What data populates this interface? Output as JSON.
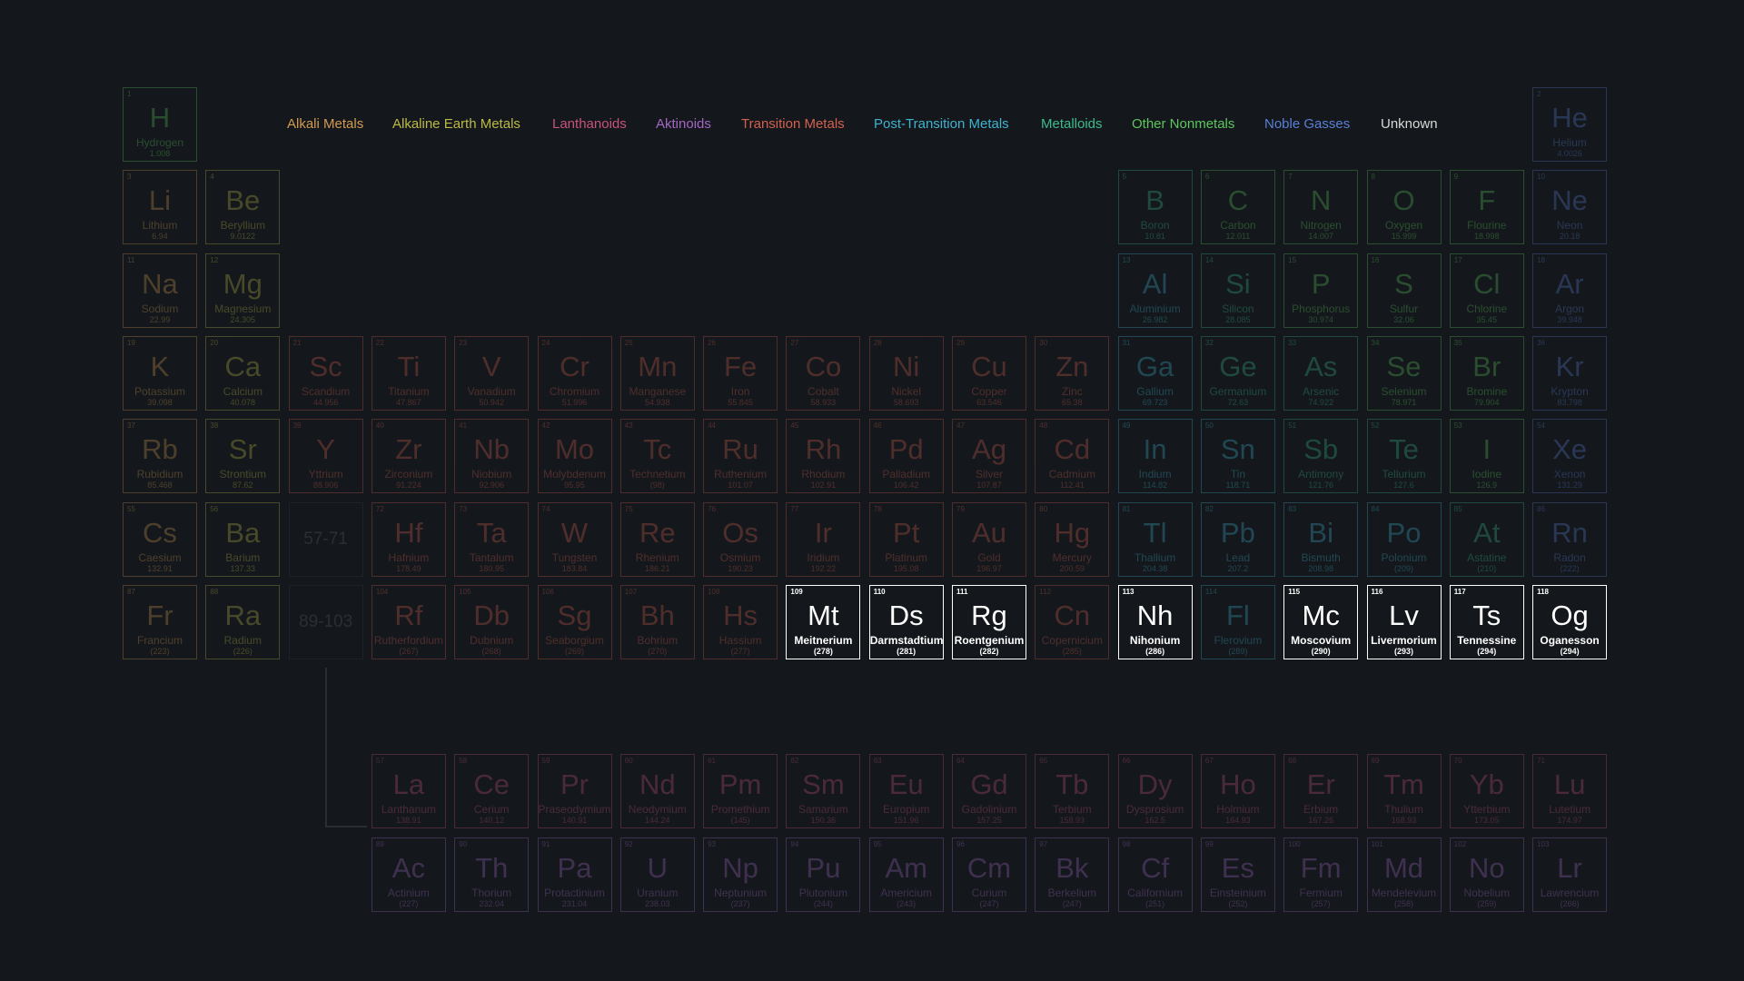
{
  "legend": [
    {
      "key": "alkali",
      "label": "Alkali Metals",
      "color": "#d29a4f"
    },
    {
      "key": "alkaline",
      "label": "Alkaline Earth Metals",
      "color": "#bdb947"
    },
    {
      "key": "lanthanoid",
      "label": "Lanthanoids",
      "color": "#c8527a"
    },
    {
      "key": "actinoid",
      "label": "Aktinoids",
      "color": "#a467c4"
    },
    {
      "key": "transition",
      "label": "Transition Metals",
      "color": "#d4604f"
    },
    {
      "key": "post",
      "label": "Post-Transition Metals",
      "color": "#3eb3cf"
    },
    {
      "key": "metalloid",
      "label": "Metalloids",
      "color": "#3cbc8c"
    },
    {
      "key": "nonmetal",
      "label": "Other Nonmetals",
      "color": "#5dc65d"
    },
    {
      "key": "noble",
      "label": "Noble Gasses",
      "color": "#5a7fd6"
    },
    {
      "key": "unknown",
      "label": "Unknown",
      "color": "#d8d8d8"
    }
  ],
  "placeholders": [
    "57-71",
    "89-103"
  ],
  "elements": [
    {
      "n": "1",
      "s": "H",
      "name": "Hydrogen",
      "m": "1.008",
      "cat": "nonmetal",
      "r": 1,
      "c": 1
    },
    {
      "n": "2",
      "s": "He",
      "name": "Helium",
      "m": "4.0026",
      "cat": "noble",
      "r": 1,
      "c": 18
    },
    {
      "n": "3",
      "s": "Li",
      "name": "Lithium",
      "m": "6.94",
      "cat": "alkali",
      "r": 2,
      "c": 1
    },
    {
      "n": "4",
      "s": "Be",
      "name": "Beryllium",
      "m": "9.0122",
      "cat": "alkaline",
      "r": 2,
      "c": 2
    },
    {
      "n": "5",
      "s": "B",
      "name": "Boron",
      "m": "10.81",
      "cat": "metalloid",
      "r": 2,
      "c": 13
    },
    {
      "n": "6",
      "s": "C",
      "name": "Carbon",
      "m": "12.011",
      "cat": "nonmetal",
      "r": 2,
      "c": 14
    },
    {
      "n": "7",
      "s": "N",
      "name": "Nitrogen",
      "m": "14.007",
      "cat": "nonmetal",
      "r": 2,
      "c": 15
    },
    {
      "n": "8",
      "s": "O",
      "name": "Oxygen",
      "m": "15.999",
      "cat": "nonmetal",
      "r": 2,
      "c": 16
    },
    {
      "n": "9",
      "s": "F",
      "name": "Flourine",
      "m": "18.998",
      "cat": "nonmetal",
      "r": 2,
      "c": 17
    },
    {
      "n": "10",
      "s": "Ne",
      "name": "Neon",
      "m": "20.18",
      "cat": "noble",
      "r": 2,
      "c": 18
    },
    {
      "n": "11",
      "s": "Na",
      "name": "Sodium",
      "m": "22.99",
      "cat": "alkali",
      "r": 3,
      "c": 1
    },
    {
      "n": "12",
      "s": "Mg",
      "name": "Magnesium",
      "m": "24.305",
      "cat": "alkaline",
      "r": 3,
      "c": 2
    },
    {
      "n": "13",
      "s": "Al",
      "name": "Aluminium",
      "m": "26.982",
      "cat": "post",
      "r": 3,
      "c": 13
    },
    {
      "n": "14",
      "s": "Si",
      "name": "Silicon",
      "m": "28.085",
      "cat": "metalloid",
      "r": 3,
      "c": 14
    },
    {
      "n": "15",
      "s": "P",
      "name": "Phosphorus",
      "m": "30.974",
      "cat": "nonmetal",
      "r": 3,
      "c": 15
    },
    {
      "n": "16",
      "s": "S",
      "name": "Sulfur",
      "m": "32.06",
      "cat": "nonmetal",
      "r": 3,
      "c": 16
    },
    {
      "n": "17",
      "s": "Cl",
      "name": "Chlorine",
      "m": "35.45",
      "cat": "nonmetal",
      "r": 3,
      "c": 17
    },
    {
      "n": "18",
      "s": "Ar",
      "name": "Argon",
      "m": "39.948",
      "cat": "noble",
      "r": 3,
      "c": 18
    },
    {
      "n": "19",
      "s": "K",
      "name": "Potassium",
      "m": "39.098",
      "cat": "alkali",
      "r": 4,
      "c": 1
    },
    {
      "n": "20",
      "s": "Ca",
      "name": "Calcium",
      "m": "40.078",
      "cat": "alkaline",
      "r": 4,
      "c": 2
    },
    {
      "n": "21",
      "s": "Sc",
      "name": "Scandium",
      "m": "44.956",
      "cat": "transition",
      "r": 4,
      "c": 3
    },
    {
      "n": "22",
      "s": "Ti",
      "name": "Titanium",
      "m": "47.867",
      "cat": "transition",
      "r": 4,
      "c": 4
    },
    {
      "n": "23",
      "s": "V",
      "name": "Vanadium",
      "m": "50.942",
      "cat": "transition",
      "r": 4,
      "c": 5
    },
    {
      "n": "24",
      "s": "Cr",
      "name": "Chromium",
      "m": "51.996",
      "cat": "transition",
      "r": 4,
      "c": 6
    },
    {
      "n": "25",
      "s": "Mn",
      "name": "Manganese",
      "m": "54.938",
      "cat": "transition",
      "r": 4,
      "c": 7
    },
    {
      "n": "26",
      "s": "Fe",
      "name": "Iron",
      "m": "55.845",
      "cat": "transition",
      "r": 4,
      "c": 8
    },
    {
      "n": "27",
      "s": "Co",
      "name": "Cobalt",
      "m": "58.933",
      "cat": "transition",
      "r": 4,
      "c": 9
    },
    {
      "n": "28",
      "s": "Ni",
      "name": "Nickel",
      "m": "58.693",
      "cat": "transition",
      "r": 4,
      "c": 10
    },
    {
      "n": "29",
      "s": "Cu",
      "name": "Copper",
      "m": "63.546",
      "cat": "transition",
      "r": 4,
      "c": 11
    },
    {
      "n": "30",
      "s": "Zn",
      "name": "Zinc",
      "m": "65.38",
      "cat": "transition",
      "r": 4,
      "c": 12
    },
    {
      "n": "31",
      "s": "Ga",
      "name": "Gallium",
      "m": "69.723",
      "cat": "post",
      "r": 4,
      "c": 13
    },
    {
      "n": "32",
      "s": "Ge",
      "name": "Germanium",
      "m": "72.63",
      "cat": "metalloid",
      "r": 4,
      "c": 14
    },
    {
      "n": "33",
      "s": "As",
      "name": "Arsenic",
      "m": "74.922",
      "cat": "metalloid",
      "r": 4,
      "c": 15
    },
    {
      "n": "34",
      "s": "Se",
      "name": "Selenium",
      "m": "78.971",
      "cat": "nonmetal",
      "r": 4,
      "c": 16
    },
    {
      "n": "35",
      "s": "Br",
      "name": "Bromine",
      "m": "79.904",
      "cat": "nonmetal",
      "r": 4,
      "c": 17
    },
    {
      "n": "36",
      "s": "Kr",
      "name": "Krypton",
      "m": "83.798",
      "cat": "noble",
      "r": 4,
      "c": 18
    },
    {
      "n": "37",
      "s": "Rb",
      "name": "Rubidium",
      "m": "85.468",
      "cat": "alkali",
      "r": 5,
      "c": 1
    },
    {
      "n": "38",
      "s": "Sr",
      "name": "Strontium",
      "m": "87.62",
      "cat": "alkaline",
      "r": 5,
      "c": 2
    },
    {
      "n": "39",
      "s": "Y",
      "name": "Yttrium",
      "m": "88.906",
      "cat": "transition",
      "r": 5,
      "c": 3
    },
    {
      "n": "40",
      "s": "Zr",
      "name": "Zirconium",
      "m": "91.224",
      "cat": "transition",
      "r": 5,
      "c": 4
    },
    {
      "n": "41",
      "s": "Nb",
      "name": "Niobium",
      "m": "92.906",
      "cat": "transition",
      "r": 5,
      "c": 5
    },
    {
      "n": "42",
      "s": "Mo",
      "name": "Molybdenum",
      "m": "95.95",
      "cat": "transition",
      "r": 5,
      "c": 6
    },
    {
      "n": "43",
      "s": "Tc",
      "name": "Technetium",
      "m": "(98)",
      "cat": "transition",
      "r": 5,
      "c": 7
    },
    {
      "n": "44",
      "s": "Ru",
      "name": "Ruthenium",
      "m": "101.07",
      "cat": "transition",
      "r": 5,
      "c": 8
    },
    {
      "n": "45",
      "s": "Rh",
      "name": "Rhodium",
      "m": "102.91",
      "cat": "transition",
      "r": 5,
      "c": 9
    },
    {
      "n": "46",
      "s": "Pd",
      "name": "Palladium",
      "m": "106.42",
      "cat": "transition",
      "r": 5,
      "c": 10
    },
    {
      "n": "47",
      "s": "Ag",
      "name": "Silver",
      "m": "107.87",
      "cat": "transition",
      "r": 5,
      "c": 11
    },
    {
      "n": "48",
      "s": "Cd",
      "name": "Cadmium",
      "m": "112.41",
      "cat": "transition",
      "r": 5,
      "c": 12
    },
    {
      "n": "49",
      "s": "In",
      "name": "Indium",
      "m": "114.82",
      "cat": "post",
      "r": 5,
      "c": 13
    },
    {
      "n": "50",
      "s": "Sn",
      "name": "Tin",
      "m": "118.71",
      "cat": "post",
      "r": 5,
      "c": 14
    },
    {
      "n": "51",
      "s": "Sb",
      "name": "Antimony",
      "m": "121.76",
      "cat": "metalloid",
      "r": 5,
      "c": 15
    },
    {
      "n": "52",
      "s": "Te",
      "name": "Tellurium",
      "m": "127.6",
      "cat": "metalloid",
      "r": 5,
      "c": 16
    },
    {
      "n": "53",
      "s": "I",
      "name": "Iodine",
      "m": "126.9",
      "cat": "nonmetal",
      "r": 5,
      "c": 17
    },
    {
      "n": "54",
      "s": "Xe",
      "name": "Xenon",
      "m": "131.29",
      "cat": "noble",
      "r": 5,
      "c": 18
    },
    {
      "n": "55",
      "s": "Cs",
      "name": "Caesium",
      "m": "132.91",
      "cat": "alkali",
      "r": 6,
      "c": 1
    },
    {
      "n": "56",
      "s": "Ba",
      "name": "Barium",
      "m": "137.33",
      "cat": "alkaline",
      "r": 6,
      "c": 2
    },
    {
      "n": "72",
      "s": "Hf",
      "name": "Hafnium",
      "m": "178.49",
      "cat": "transition",
      "r": 6,
      "c": 4
    },
    {
      "n": "73",
      "s": "Ta",
      "name": "Tantalum",
      "m": "180.95",
      "cat": "transition",
      "r": 6,
      "c": 5
    },
    {
      "n": "74",
      "s": "W",
      "name": "Tungsten",
      "m": "183.84",
      "cat": "transition",
      "r": 6,
      "c": 6
    },
    {
      "n": "75",
      "s": "Re",
      "name": "Rhenium",
      "m": "186.21",
      "cat": "transition",
      "r": 6,
      "c": 7
    },
    {
      "n": "76",
      "s": "Os",
      "name": "Osmium",
      "m": "190.23",
      "cat": "transition",
      "r": 6,
      "c": 8
    },
    {
      "n": "77",
      "s": "Ir",
      "name": "Iridium",
      "m": "192.22",
      "cat": "transition",
      "r": 6,
      "c": 9
    },
    {
      "n": "78",
      "s": "Pt",
      "name": "Platinum",
      "m": "195.08",
      "cat": "transition",
      "r": 6,
      "c": 10
    },
    {
      "n": "79",
      "s": "Au",
      "name": "Gold",
      "m": "196.97",
      "cat": "transition",
      "r": 6,
      "c": 11
    },
    {
      "n": "80",
      "s": "Hg",
      "name": "Mercury",
      "m": "200.59",
      "cat": "transition",
      "r": 6,
      "c": 12
    },
    {
      "n": "81",
      "s": "Tl",
      "name": "Thallium",
      "m": "204.38",
      "cat": "post",
      "r": 6,
      "c": 13
    },
    {
      "n": "82",
      "s": "Pb",
      "name": "Lead",
      "m": "207.2",
      "cat": "post",
      "r": 6,
      "c": 14
    },
    {
      "n": "83",
      "s": "Bi",
      "name": "Bismuth",
      "m": "208.98",
      "cat": "post",
      "r": 6,
      "c": 15
    },
    {
      "n": "84",
      "s": "Po",
      "name": "Polonium",
      "m": "(209)",
      "cat": "post",
      "r": 6,
      "c": 16
    },
    {
      "n": "85",
      "s": "At",
      "name": "Astatine",
      "m": "(210)",
      "cat": "metalloid",
      "r": 6,
      "c": 17
    },
    {
      "n": "86",
      "s": "Rn",
      "name": "Radon",
      "m": "(222)",
      "cat": "noble",
      "r": 6,
      "c": 18
    },
    {
      "n": "87",
      "s": "Fr",
      "name": "Francium",
      "m": "(223)",
      "cat": "alkali",
      "r": 7,
      "c": 1
    },
    {
      "n": "88",
      "s": "Ra",
      "name": "Radium",
      "m": "(226)",
      "cat": "alkaline",
      "r": 7,
      "c": 2
    },
    {
      "n": "104",
      "s": "Rf",
      "name": "Rutherfordium",
      "m": "(267)",
      "cat": "transition",
      "r": 7,
      "c": 4
    },
    {
      "n": "105",
      "s": "Db",
      "name": "Dubnium",
      "m": "(268)",
      "cat": "transition",
      "r": 7,
      "c": 5
    },
    {
      "n": "106",
      "s": "Sg",
      "name": "Seaborgium",
      "m": "(269)",
      "cat": "transition",
      "r": 7,
      "c": 6
    },
    {
      "n": "107",
      "s": "Bh",
      "name": "Bohrium",
      "m": "(270)",
      "cat": "transition",
      "r": 7,
      "c": 7
    },
    {
      "n": "108",
      "s": "Hs",
      "name": "Hassium",
      "m": "(277)",
      "cat": "transition",
      "r": 7,
      "c": 8
    },
    {
      "n": "109",
      "s": "Mt",
      "name": "Meitnerium",
      "m": "(278)",
      "cat": "unknown",
      "r": 7,
      "c": 9,
      "hl": true
    },
    {
      "n": "110",
      "s": "Ds",
      "name": "Darmstadtium",
      "m": "(281)",
      "cat": "unknown",
      "r": 7,
      "c": 10,
      "hl": true
    },
    {
      "n": "111",
      "s": "Rg",
      "name": "Roentgenium",
      "m": "(282)",
      "cat": "unknown",
      "r": 7,
      "c": 11,
      "hl": true
    },
    {
      "n": "112",
      "s": "Cn",
      "name": "Copernicium",
      "m": "(285)",
      "cat": "transition",
      "r": 7,
      "c": 12
    },
    {
      "n": "113",
      "s": "Nh",
      "name": "Nihonium",
      "m": "(286)",
      "cat": "unknown",
      "r": 7,
      "c": 13,
      "hl": true
    },
    {
      "n": "114",
      "s": "Fl",
      "name": "Flerovium",
      "m": "(289)",
      "cat": "post",
      "r": 7,
      "c": 14
    },
    {
      "n": "115",
      "s": "Mc",
      "name": "Moscovium",
      "m": "(290)",
      "cat": "unknown",
      "r": 7,
      "c": 15,
      "hl": true
    },
    {
      "n": "116",
      "s": "Lv",
      "name": "Livermorium",
      "m": "(293)",
      "cat": "unknown",
      "r": 7,
      "c": 16,
      "hl": true
    },
    {
      "n": "117",
      "s": "Ts",
      "name": "Tennessine",
      "m": "(294)",
      "cat": "unknown",
      "r": 7,
      "c": 17,
      "hl": true
    },
    {
      "n": "118",
      "s": "Og",
      "name": "Oganesson",
      "m": "(294)",
      "cat": "unknown",
      "r": 7,
      "c": 18,
      "hl": true
    },
    {
      "n": "57",
      "s": "La",
      "name": "Lanthanum",
      "m": "138.91",
      "cat": "lanthanoid",
      "r": 9,
      "c": 4
    },
    {
      "n": "58",
      "s": "Ce",
      "name": "Cerium",
      "m": "140.12",
      "cat": "lanthanoid",
      "r": 9,
      "c": 5
    },
    {
      "n": "59",
      "s": "Pr",
      "name": "Praseodymium",
      "m": "140.91",
      "cat": "lanthanoid",
      "r": 9,
      "c": 6
    },
    {
      "n": "60",
      "s": "Nd",
      "name": "Neodymium",
      "m": "144.24",
      "cat": "lanthanoid",
      "r": 9,
      "c": 7
    },
    {
      "n": "61",
      "s": "Pm",
      "name": "Promethium",
      "m": "(145)",
      "cat": "lanthanoid",
      "r": 9,
      "c": 8
    },
    {
      "n": "62",
      "s": "Sm",
      "name": "Samarium",
      "m": "150.36",
      "cat": "lanthanoid",
      "r": 9,
      "c": 9
    },
    {
      "n": "63",
      "s": "Eu",
      "name": "Europium",
      "m": "151.96",
      "cat": "lanthanoid",
      "r": 9,
      "c": 10
    },
    {
      "n": "64",
      "s": "Gd",
      "name": "Gadolinium",
      "m": "157.25",
      "cat": "lanthanoid",
      "r": 9,
      "c": 11
    },
    {
      "n": "65",
      "s": "Tb",
      "name": "Terbium",
      "m": "158.93",
      "cat": "lanthanoid",
      "r": 9,
      "c": 12
    },
    {
      "n": "66",
      "s": "Dy",
      "name": "Dysprosium",
      "m": "162.5",
      "cat": "lanthanoid",
      "r": 9,
      "c": 13
    },
    {
      "n": "67",
      "s": "Ho",
      "name": "Holmium",
      "m": "164.93",
      "cat": "lanthanoid",
      "r": 9,
      "c": 14
    },
    {
      "n": "68",
      "s": "Er",
      "name": "Erbium",
      "m": "167.26",
      "cat": "lanthanoid",
      "r": 9,
      "c": 15
    },
    {
      "n": "69",
      "s": "Tm",
      "name": "Thulium",
      "m": "168.93",
      "cat": "lanthanoid",
      "r": 9,
      "c": 16
    },
    {
      "n": "70",
      "s": "Yb",
      "name": "Ytterbium",
      "m": "173.05",
      "cat": "lanthanoid",
      "r": 9,
      "c": 17
    },
    {
      "n": "71",
      "s": "Lu",
      "name": "Lutetium",
      "m": "174.97",
      "cat": "lanthanoid",
      "r": 9,
      "c": 18
    },
    {
      "n": "89",
      "s": "Ac",
      "name": "Actinium",
      "m": "(227)",
      "cat": "actinoid",
      "r": 10,
      "c": 4
    },
    {
      "n": "90",
      "s": "Th",
      "name": "Thorium",
      "m": "232.04",
      "cat": "actinoid",
      "r": 10,
      "c": 5
    },
    {
      "n": "91",
      "s": "Pa",
      "name": "Protactinium",
      "m": "231.04",
      "cat": "actinoid",
      "r": 10,
      "c": 6
    },
    {
      "n": "92",
      "s": "U",
      "name": "Uranium",
      "m": "238.03",
      "cat": "actinoid",
      "r": 10,
      "c": 7
    },
    {
      "n": "93",
      "s": "Np",
      "name": "Neptunium",
      "m": "(237)",
      "cat": "actinoid",
      "r": 10,
      "c": 8
    },
    {
      "n": "94",
      "s": "Pu",
      "name": "Plutonium",
      "m": "(244)",
      "cat": "actinoid",
      "r": 10,
      "c": 9
    },
    {
      "n": "95",
      "s": "Am",
      "name": "Americium",
      "m": "(243)",
      "cat": "actinoid",
      "r": 10,
      "c": 10
    },
    {
      "n": "96",
      "s": "Cm",
      "name": "Curium",
      "m": "(247)",
      "cat": "actinoid",
      "r": 10,
      "c": 11
    },
    {
      "n": "97",
      "s": "Bk",
      "name": "Berkelium",
      "m": "(247)",
      "cat": "actinoid",
      "r": 10,
      "c": 12
    },
    {
      "n": "98",
      "s": "Cf",
      "name": "Californium",
      "m": "(251)",
      "cat": "actinoid",
      "r": 10,
      "c": 13
    },
    {
      "n": "99",
      "s": "Es",
      "name": "Einsteinium",
      "m": "(252)",
      "cat": "actinoid",
      "r": 10,
      "c": 14
    },
    {
      "n": "100",
      "s": "Fm",
      "name": "Fermium",
      "m": "(257)",
      "cat": "actinoid",
      "r": 10,
      "c": 15
    },
    {
      "n": "101",
      "s": "Md",
      "name": "Mendelevium",
      "m": "(258)",
      "cat": "actinoid",
      "r": 10,
      "c": 16
    },
    {
      "n": "102",
      "s": "No",
      "name": "Nobelium",
      "m": "(259)",
      "cat": "actinoid",
      "r": 10,
      "c": 17
    },
    {
      "n": "103",
      "s": "Lr",
      "name": "Lawrencium",
      "m": "(266)",
      "cat": "actinoid",
      "r": 10,
      "c": 18
    }
  ]
}
